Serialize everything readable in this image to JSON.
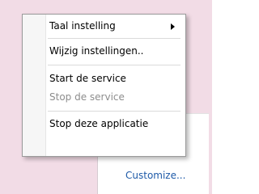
{
  "colors": {
    "desktop_background": "#f2dce6",
    "link": "#1e5aa8",
    "disabled_text": "#8d8d8d"
  },
  "context_menu": {
    "items": [
      {
        "label": "Taal instelling",
        "has_submenu": true,
        "enabled": true
      },
      {
        "label": "Wijzig instellingen..",
        "has_submenu": false,
        "enabled": true
      },
      {
        "label": "Start de service",
        "has_submenu": false,
        "enabled": true
      },
      {
        "label": "Stop de service",
        "has_submenu": false,
        "enabled": false
      },
      {
        "label": "Stop deze applicatie",
        "has_submenu": false,
        "enabled": true
      }
    ]
  },
  "tray_flyout": {
    "icons": [
      "green-app-icon",
      "generic-tray-icon"
    ],
    "customize_link": "Customize..."
  }
}
